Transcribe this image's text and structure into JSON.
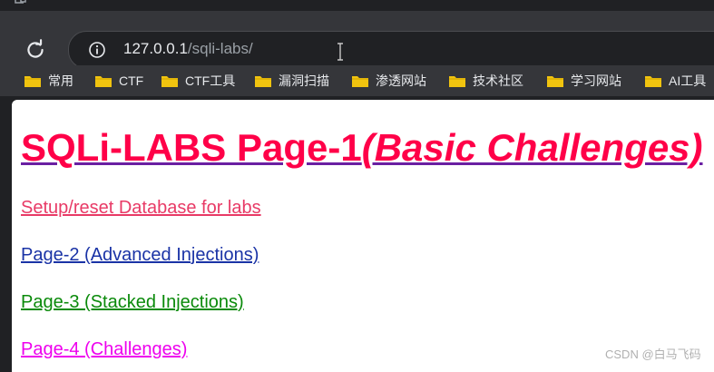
{
  "browser": {
    "url_host": "127.0.0.1",
    "url_path": "/sqli-labs/",
    "bookmarks": [
      {
        "label": "常用"
      },
      {
        "label": "CTF"
      },
      {
        "label": "CTF工具"
      },
      {
        "label": "漏洞扫描"
      },
      {
        "label": "渗透网站"
      },
      {
        "label": "技术社区"
      },
      {
        "label": "学习网站"
      },
      {
        "label": "AI工具"
      }
    ]
  },
  "page": {
    "title_main": "SQLi-LABS Page-1",
    "title_em": "(Basic Challenges)",
    "links": [
      {
        "label": "Setup/reset Database for labs"
      },
      {
        "label": "Page-2 (Advanced Injections)"
      },
      {
        "label": "Page-3 (Stacked Injections)"
      },
      {
        "label": "Page-4 (Challenges)"
      }
    ]
  },
  "watermark": "CSDN @白马飞码",
  "colors": {
    "title": "#ff0048",
    "title_underline": "#6a1fa2",
    "setup_link": "#e83a66",
    "page2_link": "#1a33a6",
    "page3_link": "#0a8a0a",
    "page4_link": "#ee00ee",
    "folder": "#f1c40f"
  }
}
